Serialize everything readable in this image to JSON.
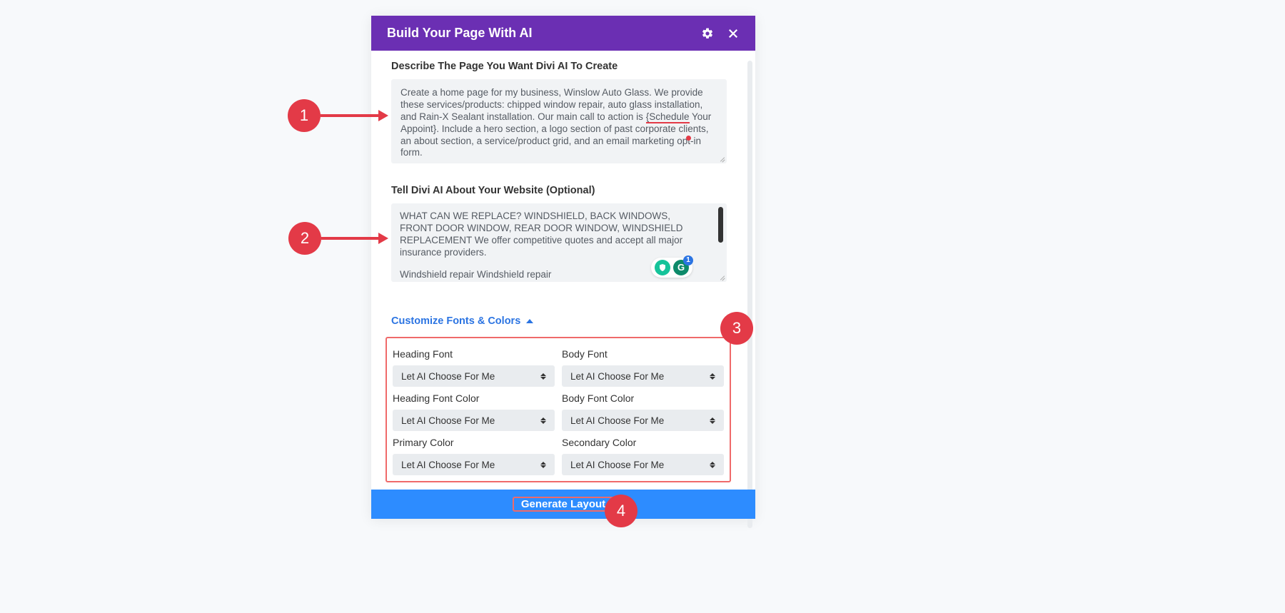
{
  "modal": {
    "title": "Build Your Page With AI",
    "describe_label": "Describe The Page You Want Divi AI To Create",
    "describe_value_pre": "Create a home page for my business, Winslow Auto Glass. We provide these services/products: chipped window repair, auto glass installation, and Rain-X Sealant installation. Our main call to action is ",
    "describe_underlined": "{Schedule",
    "describe_value_post": " Your Appoint}. Include a hero section, a logo section of past corporate clients, an about section, a service/product grid, and an email marketing opt-in form.",
    "website_label": "Tell Divi AI About Your Website (Optional)",
    "website_value_line1": "WHAT CAN WE REPLACE? WINDSHIELD, BACK WINDOWS, FRONT DOOR WINDOW, REAR DOOR WINDOW, WINDSHIELD REPLACEMENT We offer competitive quotes and accept all major insurance providers.",
    "website_value_line2": "Windshield repair Windshield repair",
    "customize_label": "Customize Fonts & Colors",
    "options": {
      "heading_font": {
        "label": "Heading Font",
        "value": "Let AI Choose For Me"
      },
      "body_font": {
        "label": "Body Font",
        "value": "Let AI Choose For Me"
      },
      "heading_font_color": {
        "label": "Heading Font Color",
        "value": "Let AI Choose For Me"
      },
      "body_font_color": {
        "label": "Body Font Color",
        "value": "Let AI Choose For Me"
      },
      "primary_color": {
        "label": "Primary Color",
        "value": "Let AI Choose For Me"
      },
      "secondary_color": {
        "label": "Secondary Color",
        "value": "Let AI Choose For Me"
      }
    },
    "generate_label": "Generate Layout"
  },
  "callouts": {
    "c1": "1",
    "c2": "2",
    "c3": "3",
    "c4": "4"
  },
  "grammarly_badge": "1"
}
